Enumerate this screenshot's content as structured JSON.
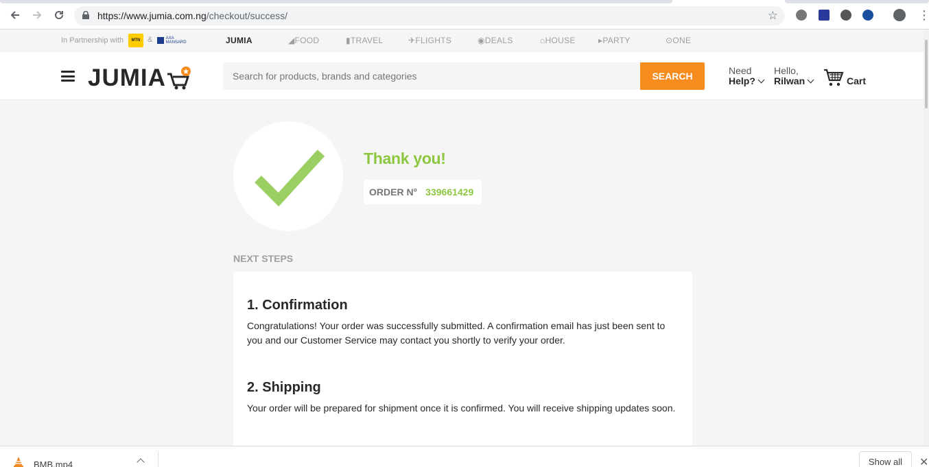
{
  "browser": {
    "url_domain": "https://www.jumia.com.ng",
    "url_path": "/checkout/success/"
  },
  "partner_bar": {
    "partner_text": "In Partnership with",
    "mtn_label": "MTN",
    "ampersand": "&",
    "axa_label": "AXA MANSARD",
    "sister_sites": [
      "JUMIA",
      "FOOD",
      "TRAVEL",
      "FLIGHTS",
      "DEALS",
      "HOUSE",
      "PARTY",
      "ONE"
    ]
  },
  "header": {
    "logo_text": "JUMIA",
    "search_placeholder": "Search for products, brands and categories",
    "search_button": "SEARCH",
    "help_line1": "Need",
    "help_line2": "Help?",
    "account_line1": "Hello,",
    "account_line2": "Rilwan",
    "cart_label": "Cart"
  },
  "main": {
    "thanks": "Thank you!",
    "order_label": "ORDER N°",
    "order_number": "339661429",
    "next_steps": "NEXT STEPS",
    "steps": [
      {
        "title": "1. Confirmation",
        "text": "Congratulations! Your order was successfully submitted. A confirmation email has just been sent to you and our Customer Service may contact you shortly to verify your order."
      },
      {
        "title": "2. Shipping",
        "text": "Your order will be prepared for shipment once it is confirmed. You will receive shipping updates soon."
      }
    ]
  },
  "downloads": {
    "file_name": "BMB.mp4",
    "show_all": "Show all"
  },
  "colors": {
    "accent_orange": "#f68b1e",
    "success_green": "#8dc63f"
  }
}
